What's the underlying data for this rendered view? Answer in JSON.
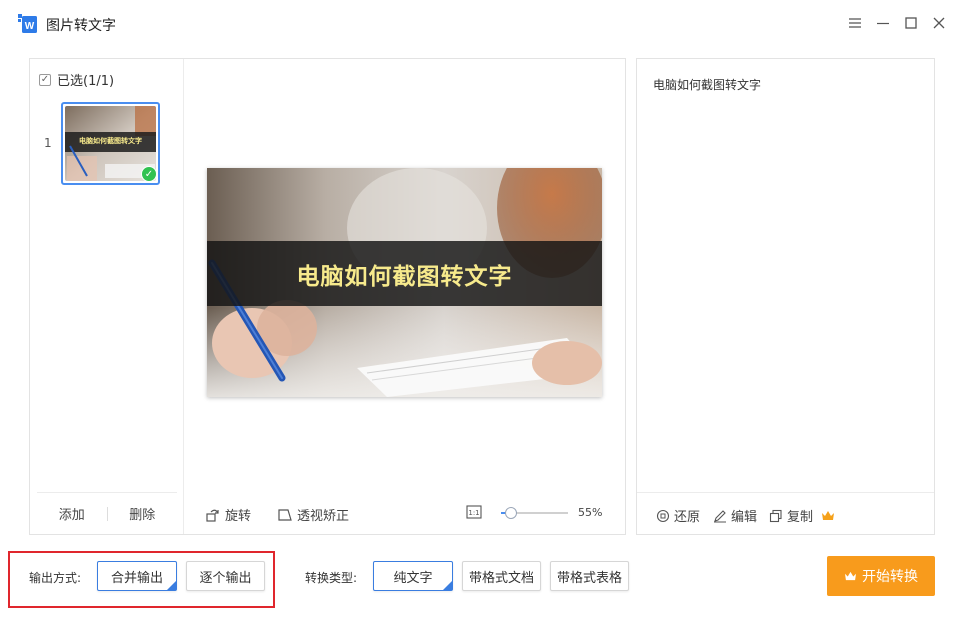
{
  "app": {
    "title": "图片转文字"
  },
  "window_controls": {
    "menu": "menu-icon",
    "minimize": "minimize-icon",
    "maximize": "maximize-icon",
    "close": "close-icon"
  },
  "file_list": {
    "select_all_label": "已选(1/1)",
    "items": [
      {
        "index": "1",
        "thumb_caption": "电脑如何截图转文字",
        "checked": true
      }
    ],
    "add_label": "添加",
    "delete_label": "删除"
  },
  "preview": {
    "image_caption": "电脑如何截图转文字",
    "rotate_label": "旋转",
    "perspective_label": "透视矫正",
    "zoom_percent": "55%",
    "zoom_level": 0.15
  },
  "result": {
    "text": "电脑如何截图转文字",
    "restore_label": "还原",
    "edit_label": "编辑",
    "copy_label": "复制"
  },
  "bottom": {
    "output_label": "输出方式:",
    "output_options": [
      "合并输出",
      "逐个输出"
    ],
    "output_selected": "合并输出",
    "convert_type_label": "转换类型:",
    "convert_options": [
      "纯文字",
      "带格式文档",
      "带格式表格"
    ],
    "convert_selected": "纯文字",
    "start_label": "开始转换"
  },
  "colors": {
    "accent": "#3a7de0",
    "start_button": "#f89b1c",
    "highlight": "#e0262d",
    "check_badge": "#32c251",
    "caption_text": "#f7ea8c"
  }
}
